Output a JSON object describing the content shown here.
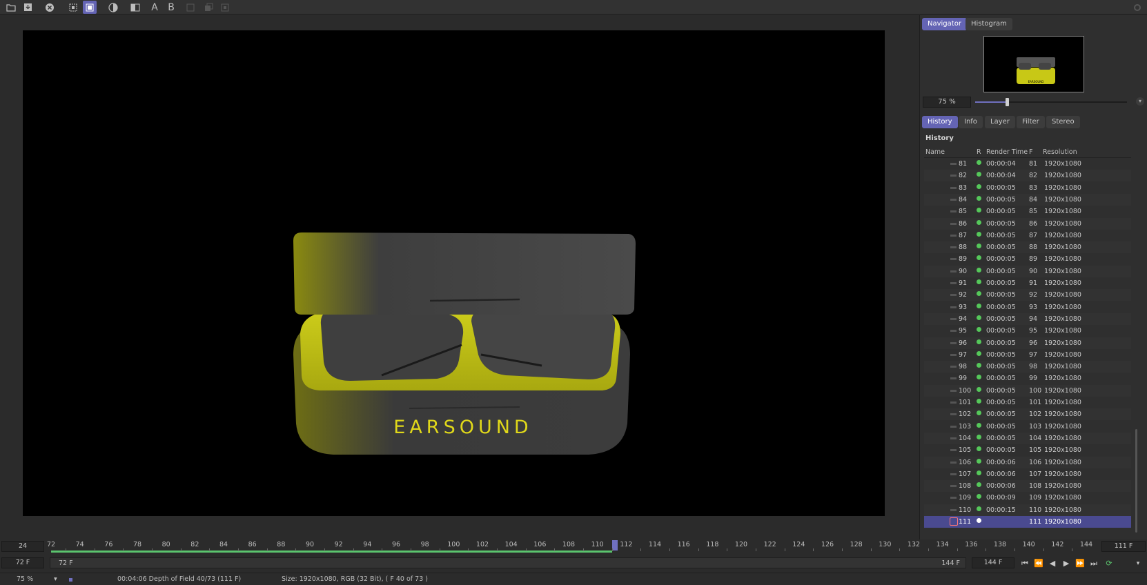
{
  "toolbar": {
    "buttons": [
      {
        "icon": "open-folder-icon"
      },
      {
        "icon": "save-icon"
      },
      {
        "icon": "close-icon"
      },
      {
        "icon": "region-render-icon"
      },
      {
        "icon": "auto-save-icon"
      },
      {
        "icon": "contrast-icon"
      },
      {
        "icon": "compare-icon"
      },
      {
        "icon": "A",
        "label": "A"
      },
      {
        "icon": "B",
        "label": "B"
      }
    ]
  },
  "render": {
    "brand_text": "EARSOUND",
    "accent": "#e0d81a"
  },
  "navigator": {
    "tabs": [
      "Navigator",
      "Histogram"
    ],
    "active_tab": "Navigator",
    "thumb_text": "EARSOUND",
    "zoom_value": "75 %",
    "zoom_level": 0.2
  },
  "lower_tabs": [
    "History",
    "Info",
    "Layer",
    "Filter",
    "Stereo"
  ],
  "history": {
    "title": "History",
    "columns": {
      "name": "Name",
      "r": "R",
      "render_time": "Render Time",
      "f": "F",
      "resolution": "Resolution"
    },
    "rows": [
      {
        "name": "81",
        "time": "00:00:04",
        "f": "81",
        "res": "1920x1080"
      },
      {
        "name": "82",
        "time": "00:00:04",
        "f": "82",
        "res": "1920x1080"
      },
      {
        "name": "83",
        "time": "00:00:05",
        "f": "83",
        "res": "1920x1080"
      },
      {
        "name": "84",
        "time": "00:00:05",
        "f": "84",
        "res": "1920x1080"
      },
      {
        "name": "85",
        "time": "00:00:05",
        "f": "85",
        "res": "1920x1080"
      },
      {
        "name": "86",
        "time": "00:00:05",
        "f": "86",
        "res": "1920x1080"
      },
      {
        "name": "87",
        "time": "00:00:05",
        "f": "87",
        "res": "1920x1080"
      },
      {
        "name": "88",
        "time": "00:00:05",
        "f": "88",
        "res": "1920x1080"
      },
      {
        "name": "89",
        "time": "00:00:05",
        "f": "89",
        "res": "1920x1080"
      },
      {
        "name": "90",
        "time": "00:00:05",
        "f": "90",
        "res": "1920x1080"
      },
      {
        "name": "91",
        "time": "00:00:05",
        "f": "91",
        "res": "1920x1080"
      },
      {
        "name": "92",
        "time": "00:00:05",
        "f": "92",
        "res": "1920x1080"
      },
      {
        "name": "93",
        "time": "00:00:05",
        "f": "93",
        "res": "1920x1080"
      },
      {
        "name": "94",
        "time": "00:00:05",
        "f": "94",
        "res": "1920x1080"
      },
      {
        "name": "95",
        "time": "00:00:05",
        "f": "95",
        "res": "1920x1080"
      },
      {
        "name": "96",
        "time": "00:00:05",
        "f": "96",
        "res": "1920x1080"
      },
      {
        "name": "97",
        "time": "00:00:05",
        "f": "97",
        "res": "1920x1080"
      },
      {
        "name": "98",
        "time": "00:00:05",
        "f": "98",
        "res": "1920x1080"
      },
      {
        "name": "99",
        "time": "00:00:05",
        "f": "99",
        "res": "1920x1080"
      },
      {
        "name": "100",
        "time": "00:00:05",
        "f": "100",
        "res": "1920x1080"
      },
      {
        "name": "101",
        "time": "00:00:05",
        "f": "101",
        "res": "1920x1080"
      },
      {
        "name": "102",
        "time": "00:00:05",
        "f": "102",
        "res": "1920x1080"
      },
      {
        "name": "103",
        "time": "00:00:05",
        "f": "103",
        "res": "1920x1080"
      },
      {
        "name": "104",
        "time": "00:00:05",
        "f": "104",
        "res": "1920x1080"
      },
      {
        "name": "105",
        "time": "00:00:05",
        "f": "105",
        "res": "1920x1080"
      },
      {
        "name": "106",
        "time": "00:00:06",
        "f": "106",
        "res": "1920x1080"
      },
      {
        "name": "107",
        "time": "00:00:06",
        "f": "107",
        "res": "1920x1080"
      },
      {
        "name": "108",
        "time": "00:00:06",
        "f": "108",
        "res": "1920x1080"
      },
      {
        "name": "109",
        "time": "00:00:09",
        "f": "109",
        "res": "1920x1080"
      },
      {
        "name": "110",
        "time": "00:00:15",
        "f": "110",
        "res": "1920x1080"
      },
      {
        "name": "111",
        "time": "",
        "f": "111",
        "res": "1920x1080",
        "selected": true
      }
    ]
  },
  "timeline": {
    "fps": "24",
    "current_frame": "111 F",
    "ticks": [
      "72",
      "74",
      "76",
      "78",
      "80",
      "82",
      "84",
      "86",
      "88",
      "90",
      "92",
      "94",
      "96",
      "98",
      "100",
      "102",
      "104",
      "106",
      "108",
      "110",
      "112",
      "114",
      "116",
      "118",
      "120",
      "122",
      "124",
      "126",
      "128",
      "130",
      "132",
      "134",
      "136",
      "138",
      "140",
      "142",
      "144"
    ],
    "start": 72,
    "end": 144,
    "rendered_to": 111,
    "range_start": "72 F",
    "range_start_inner": "72 F",
    "range_end_inner": "144 F",
    "range_end": "144 F"
  },
  "status": {
    "zoom": "75 %",
    "progress_text": "00:04:06 Depth of Field 40/73 (111 F)",
    "info_text": "Size: 1920x1080, RGB (32 Bit),  ( F 40 of 73 )"
  },
  "colors": {
    "accent": "#6464b4",
    "rendered": "#5bc46e"
  }
}
